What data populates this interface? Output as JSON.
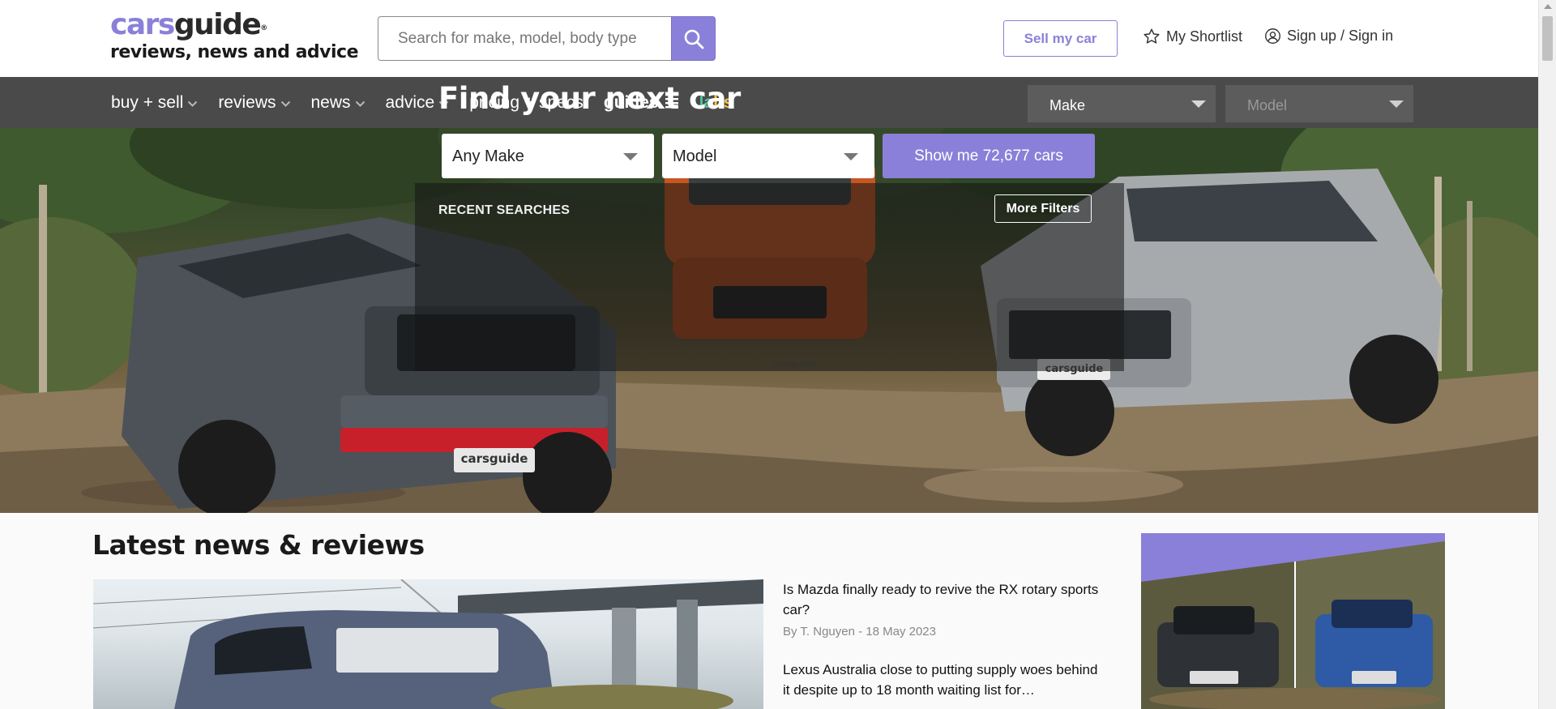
{
  "header": {
    "logo_part1": "cars",
    "logo_part2": "guide",
    "logo_reg": "®",
    "tagline": "reviews, news and advice",
    "search_placeholder": "Search for make, model, body type",
    "sell_label": "Sell my car",
    "shortlist_label": "My Shortlist",
    "signin_label": "Sign up / Sign in"
  },
  "nav": {
    "items": [
      {
        "label": "buy + sell",
        "dropdown": true
      },
      {
        "label": "reviews",
        "dropdown": true
      },
      {
        "label": "news",
        "dropdown": true
      },
      {
        "label": "advice",
        "dropdown": true
      },
      {
        "label": "pricing + specs",
        "dropdown": false
      }
    ],
    "guides_label": "guides",
    "labs_l": "la",
    "labs_b": "bs",
    "make_select": "Make",
    "model_select": "Model"
  },
  "hero": {
    "title": "Find your next car",
    "make_select": "Any Make",
    "model_select": "Model",
    "cta_label": "Show me 72,677 cars",
    "recent_label": "RECENT SEARCHES",
    "filters_label": "More Filters",
    "plate_1": "carsguide",
    "plate_2": "carsguide",
    "plate_3": "carsguide"
  },
  "main": {
    "section_title": "Latest news & reviews",
    "articles": [
      {
        "title": "Is Mazda finally ready to revive the RX rotary sports car?",
        "byline": "By T. Nguyen - 18 May 2023"
      },
      {
        "title": "Lexus Australia close to putting supply woes behind it despite up to 18 month waiting list for…",
        "byline": ""
      }
    ]
  },
  "colors": {
    "brand_purple": "#8a80d9",
    "nav_bg": "#4a4a4a",
    "labs_green": "#4ec0a0",
    "labs_yellow": "#f4c542"
  },
  "icons": [
    "search-icon",
    "star-icon",
    "user-icon",
    "chevron-down-icon",
    "hamburger-icon"
  ]
}
